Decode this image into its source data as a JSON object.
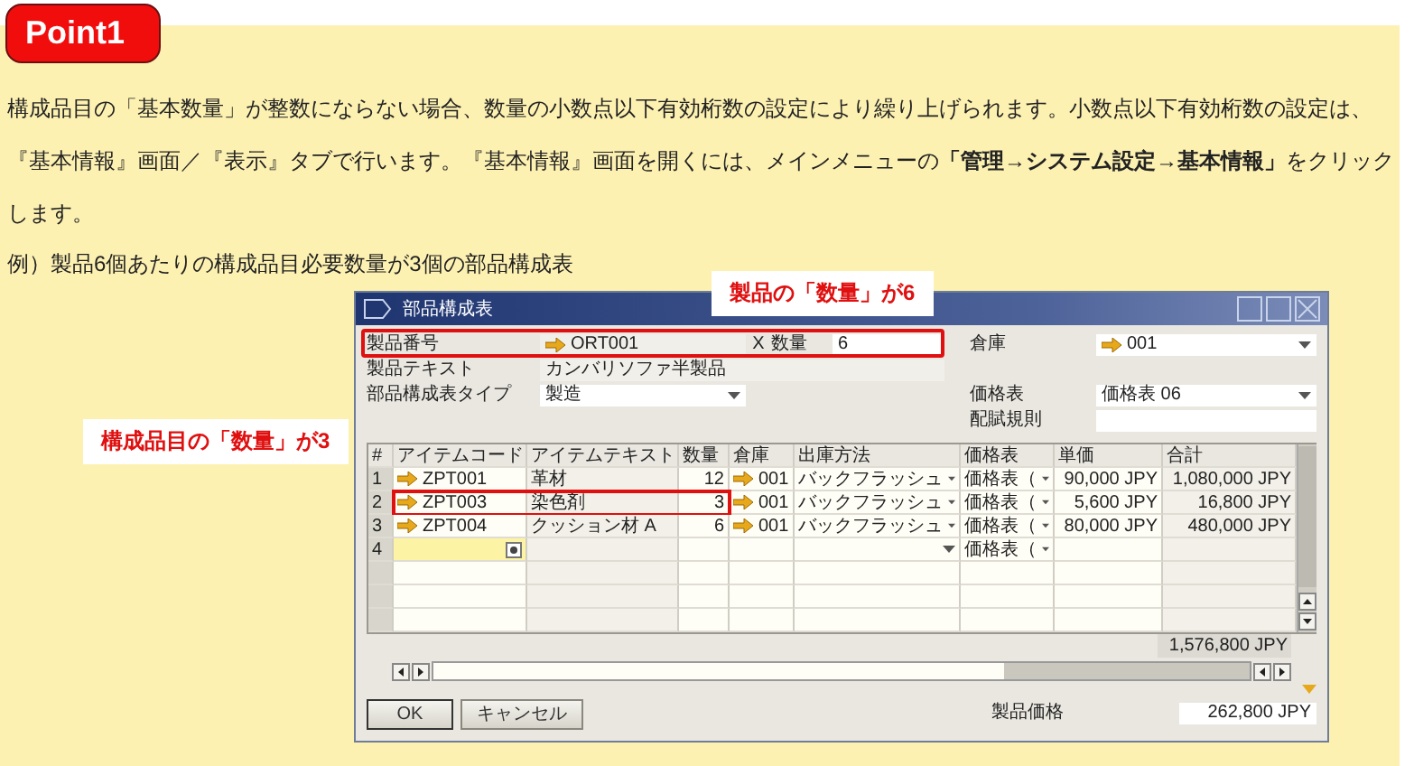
{
  "badge": "Point1",
  "paragraph": "構成品目の「基本数量」が整数にならない場合、数量の小数点以下有効桁数の設定により繰り上げられます。小数点以下有効桁数の設定は、『基本情報』画面／『表示』タブで行います。『基本情報』画面を開くには、メインメニューの**「管理→システム設定→基本情報」**をクリックします。",
  "example": "例）製品6個あたりの構成品目必要数量が3個の部品構成表",
  "callouts": [
    {
      "text": "製品の「数量」が6"
    },
    {
      "text": "構成品目の「数量」が3"
    }
  ],
  "window": {
    "title": "部品構成表",
    "form": {
      "product_no": {
        "label": "製品番号",
        "value": "ORT001",
        "highlighted": true
      },
      "x_mark": "X",
      "quantity": {
        "label": "数量",
        "value": "6"
      },
      "product_text": {
        "label": "製品テキスト",
        "value": "カンバリソファ半製品"
      },
      "bom_type": {
        "label": "部品構成表タイプ",
        "value": "製造"
      },
      "warehouse": {
        "label": "倉庫",
        "value": "001"
      },
      "price_list": {
        "label": "価格表",
        "value": "価格表 06"
      },
      "distribution_rule": {
        "label": "配賦規則"
      }
    },
    "table": {
      "columns": [
        "#",
        "アイテムコード",
        "アイテムテキスト",
        "数量",
        "倉庫",
        "出庫方法",
        "価格表",
        "単価",
        "合計"
      ],
      "rows": [
        {
          "no": "1",
          "code": "ZPT001",
          "text": "革材",
          "qty": "12",
          "warehouse": "001",
          "method": "バックフラッシュ",
          "price_list": "価格表（",
          "price": "90,000 JPY",
          "total": "1,080,000 JPY",
          "highlighted": false,
          "current": false
        },
        {
          "no": "2",
          "code": "ZPT003",
          "text": "染色剤",
          "qty": "3",
          "warehouse": "001",
          "method": "バックフラッシュ",
          "price_list": "価格表（",
          "price": "5,600 JPY",
          "total": "16,800 JPY",
          "highlighted": true,
          "current": false
        },
        {
          "no": "3",
          "code": "ZPT004",
          "text": "クッション材 A",
          "qty": "6",
          "warehouse": "001",
          "method": "バックフラッシュ",
          "price_list": "価格表（",
          "price": "80,000 JPY",
          "total": "480,000 JPY",
          "highlighted": false,
          "current": false
        },
        {
          "no": "4",
          "price_list": "価格表（",
          "highlighted": false,
          "current": true
        }
      ],
      "total": "1,576,800 JPY"
    },
    "product_price": {
      "label": "製品価格",
      "value": "262,800 JPY"
    },
    "buttons": [
      "OK",
      "キャンセル"
    ]
  }
}
